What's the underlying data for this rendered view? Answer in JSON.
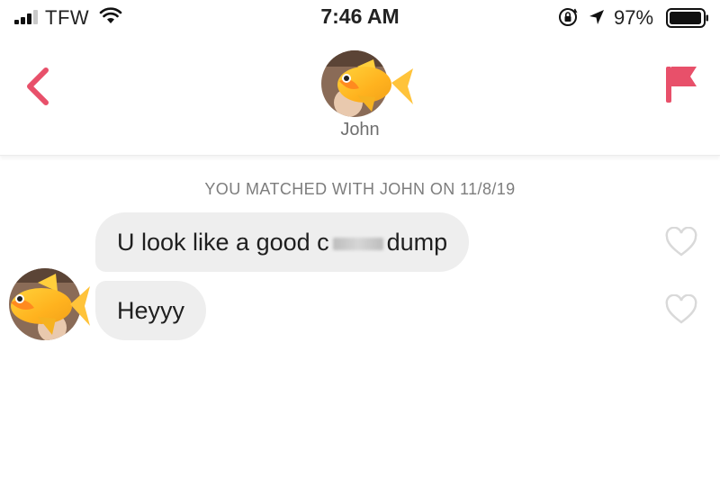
{
  "status_bar": {
    "carrier": "TFW",
    "time": "7:46 AM",
    "battery_percent": "97%",
    "icons": [
      "signal-icon",
      "wifi-icon",
      "rotation-lock-icon",
      "location-arrow-icon",
      "battery-icon"
    ]
  },
  "header": {
    "back_icon": "chevron-left-icon",
    "report_icon": "flag-icon",
    "match_name": "John",
    "avatar_icon": "goldfish-avatar"
  },
  "conversation": {
    "match_banner": "YOU MATCHED WITH JOHN ON 11/8/19",
    "messages": [
      {
        "text_before": "U look like a good c",
        "text_after": "dump",
        "censored": true,
        "liked": false
      },
      {
        "text": "Heyyy",
        "liked": false
      }
    ]
  },
  "colors": {
    "accent": "#e8506a",
    "bubble_bg": "#eeeeee",
    "banner_text": "#7d7d7d",
    "heart_outline": "#d9d9d9"
  }
}
